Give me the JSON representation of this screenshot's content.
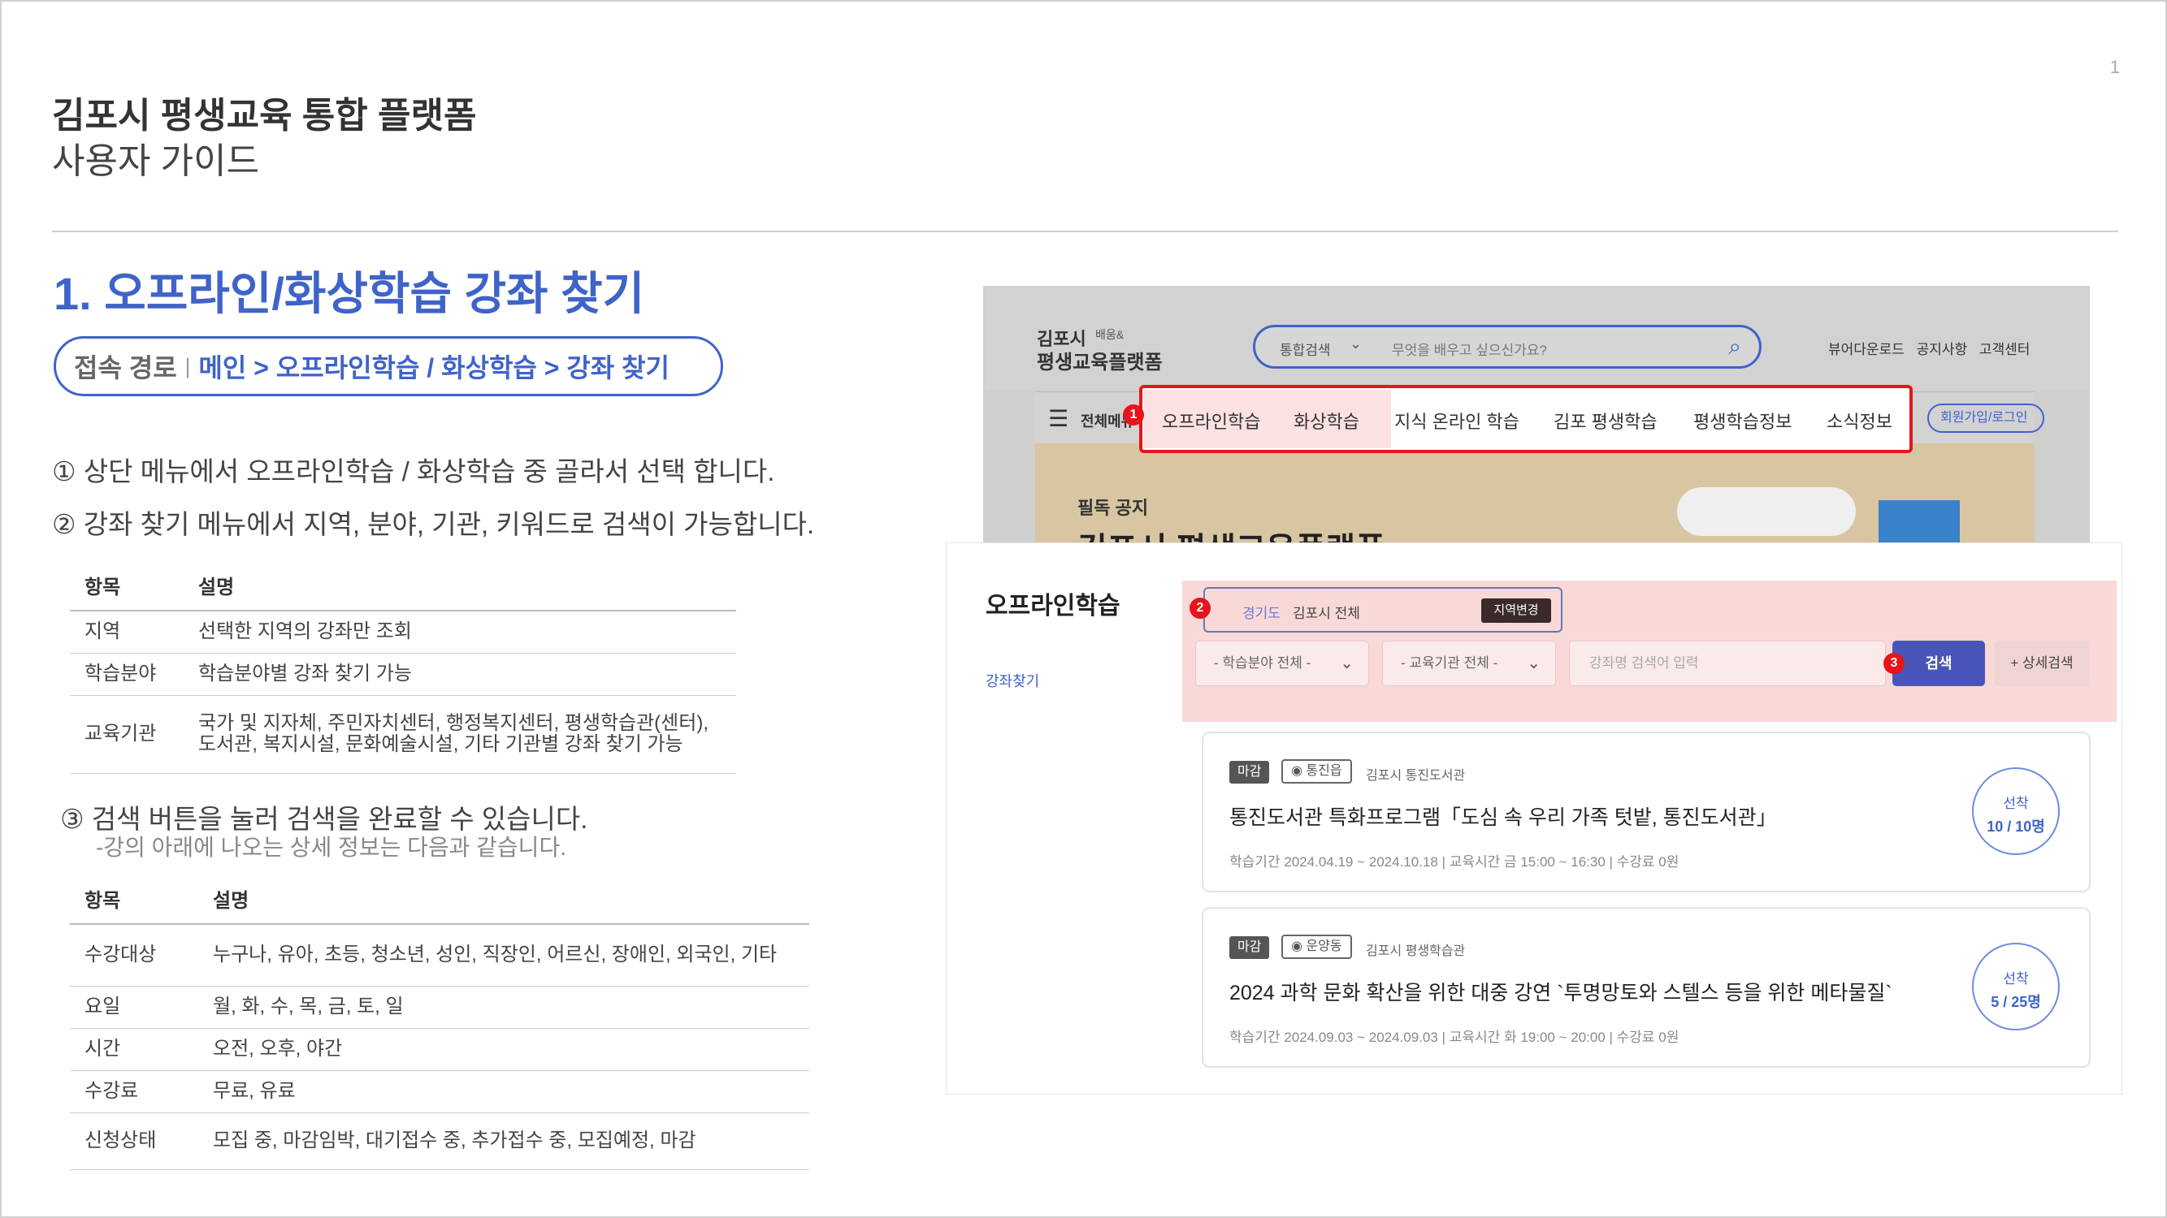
{
  "page_number": "1",
  "header": {
    "title": "김포시 평생교육 통합 플랫폼",
    "subtitle": "사용자 가이드"
  },
  "section": {
    "title": "1. 오프라인/화상학습 강좌 찾기",
    "path_label": "접속 경로",
    "path_value": "메인 > 오프라인학습 / 화상학습 > 강좌 찾기"
  },
  "steps": {
    "step1": "① 상단 메뉴에서 오프라인학습 / 화상학습 중 골라서 선택 합니다.",
    "step2": "② 강좌 찾기 메뉴에서 지역, 분야, 기관, 키워드로 검색이 가능합니다.",
    "step3": "③ 검색 버튼을 눌러 검색을 완료할 수 있습니다.",
    "step3_note": "-강의 아래에 나오는 상세 정보는 다음과 같습니다."
  },
  "table1": {
    "headers": [
      "항목",
      "설명"
    ],
    "rows": [
      {
        "item": "지역",
        "desc": "선택한 지역의 강좌만 조회"
      },
      {
        "item": "학습분야",
        "desc": "학습분야별 강좌 찾기 가능"
      },
      {
        "item": "교육기관",
        "desc_line1": "국가 및 지자체, 주민자치센터, 행정복지센터, 평생학습관(센터),",
        "desc_line2": "도서관, 복지시설, 문화예술시설, 기타 기관별 강좌 찾기 가능"
      }
    ]
  },
  "table2": {
    "headers": [
      "항목",
      "설명"
    ],
    "rows": [
      {
        "item": "수강대상",
        "desc": "누구나, 유아, 초등, 청소년, 성인, 직장인, 어르신, 장애인, 외국인, 기타"
      },
      {
        "item": "요일",
        "desc": "월, 화, 수, 목, 금, 토, 일"
      },
      {
        "item": "시간",
        "desc": "오전, 오후, 야간"
      },
      {
        "item": "수강료",
        "desc": "무료, 유료"
      },
      {
        "item": "신청상태",
        "desc": "모집 중, 마감임박, 대기접수 중, 추가접수 중, 모집예정, 마감"
      }
    ]
  },
  "screenshot_top": {
    "logo_line1": "김포시",
    "logo_tag": "배움&",
    "logo_line2": "평생교육플랫폼",
    "search_option": "통합검색",
    "search_placeholder": "무엇을 배우고 싶으신가요?",
    "top_links": "뷰어다운로드 공지사항 고객센터",
    "all_menu": "전체메뉴",
    "login": "회원가입/로그인",
    "menu": [
      "오프라인학습",
      "화상학습",
      "지식 온라인 학습",
      "김포 평생학습",
      "평생학습정보",
      "소식정보"
    ],
    "banner_label": "필독 공지",
    "banner_title": "김포시 평생교육플랫폼"
  },
  "screenshot_front": {
    "title": "오프라인학습",
    "side_link": "강좌찾기",
    "region_prov": "경기도",
    "region_city": "김포시 전체",
    "region_btn": "지역변경",
    "field_select": "- 학습분야 전체 -",
    "inst_select": "- 교육기관 전체 -",
    "keyword_placeholder": "강좌명 검색어 입력",
    "search_btn": "검색",
    "detail_btn": "+ 상세검색",
    "cards": [
      {
        "status": "마감",
        "location": "통진읍",
        "org": "김포시 통진도서관",
        "title": "통진도서관 특화프로그램「도심 속 우리 가족 텃밭, 통진도서관」",
        "meta": "학습기간  2024.04.19 ~ 2024.10.18  |  교육시간  금 15:00 ~ 16:30  |  수강료  0원",
        "cap_label": "선착",
        "cap_count": "10 / 10명"
      },
      {
        "status": "마감",
        "location": "운양동",
        "org": "김포시 평생학습관",
        "title": "2024 과학 문화 확산을 위한 대중 강연 `투명망토와 스텔스 등을 위한 메타물질`",
        "meta": "학습기간  2024.09.03 ~ 2024.09.03  |  교육시간  화 19:00 ~ 20:00  |  수강료  0원",
        "cap_label": "선착",
        "cap_count": "5 / 25명"
      }
    ]
  },
  "badges": [
    "1",
    "2",
    "3"
  ]
}
